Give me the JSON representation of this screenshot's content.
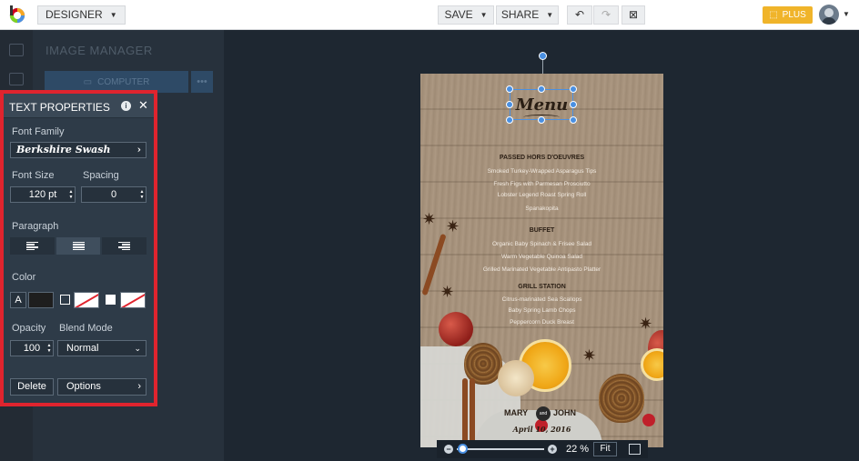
{
  "topbar": {
    "mode_label": "DESIGNER",
    "save_label": "SAVE",
    "share_label": "SHARE",
    "plus_label": "PLUS"
  },
  "image_manager": {
    "title": "IMAGE MANAGER",
    "computer_label": "COMPUTER",
    "more_label": "•••"
  },
  "text_properties": {
    "title": "TEXT PROPERTIES",
    "font_family_label": "Font Family",
    "font_family_value": "Berkshire Swash",
    "font_size_label": "Font Size",
    "font_size_value": "120 pt",
    "spacing_label": "Spacing",
    "spacing_value": "0",
    "paragraph_label": "Paragraph",
    "color_label": "Color",
    "color_a_label": "A",
    "opacity_label": "Opacity",
    "opacity_value": "100",
    "blend_mode_label": "Blend Mode",
    "blend_mode_value": "Normal",
    "delete_label": "Delete",
    "options_label": "Options",
    "text_color": "#1e1e1e"
  },
  "design": {
    "menu_title": "Menu",
    "sections": [
      {
        "heading": "PASSED HORS D'OEUVRES",
        "items": [
          "Smoked Turkey-Wrapped Asparagus Tips",
          "Fresh Figs with Parmesan Prosciutto",
          "Lobster Legend Roast Spring Roll",
          "Spanakopita"
        ]
      },
      {
        "heading": "BUFFET",
        "items": [
          "Organic Baby Spinach & Frisee Salad",
          "Warm Vegetable Quinoa Salad",
          "Grilled Marinated Vegetable Antipasto Platter"
        ]
      },
      {
        "heading": "GRILL STATION",
        "items": [
          "Citrus-marinated Sea Scallops",
          "Baby Spring Lamb Chops",
          "Peppercorn Duck Breast"
        ]
      }
    ],
    "name_left": "MARY",
    "name_and": "and",
    "name_right": "JOHN",
    "date": "April 10, 2016"
  },
  "zoom": {
    "percent_label": "22 %",
    "fit_label": "Fit",
    "level": 0.06
  },
  "colors": {
    "accent": "#4a90e2",
    "highlight_border": "#e0242e",
    "plus_button": "#f0b42a"
  }
}
